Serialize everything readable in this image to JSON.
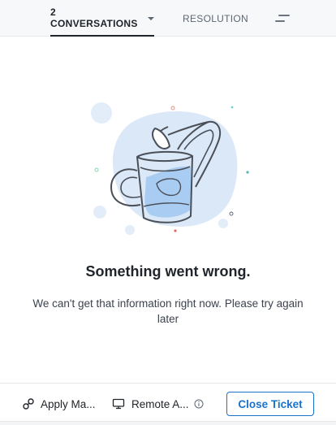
{
  "tabs": {
    "conversations_label": "2 CONVERSATIONS",
    "resolution_label": "RESOLUTION",
    "menu_icon": "menu-lines-icon"
  },
  "empty_state": {
    "title": "Something went wrong.",
    "message": "We can't get that information right now. Please try again later",
    "illustration": "watering-can-illustration"
  },
  "actions": {
    "apply_macro_label": "Apply Ma...",
    "apply_macro_icon": "macro-link-icon",
    "remote_assist_label": "Remote A...",
    "remote_assist_icon": "monitor-icon",
    "info_icon": "info-icon",
    "close_ticket_label": "Close Ticket"
  },
  "colors": {
    "accent": "#1a73c9",
    "illustration_blob": "#dbe8f7",
    "illustration_water": "#a9ccf2",
    "text_primary": "#20242b"
  }
}
